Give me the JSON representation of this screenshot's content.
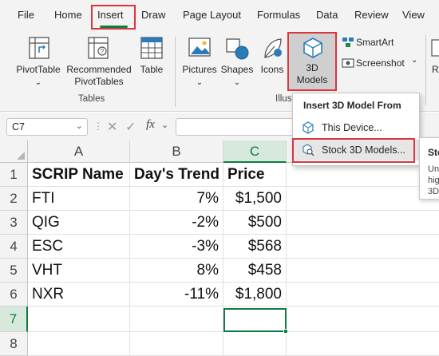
{
  "tabs": [
    "File",
    "Home",
    "Insert",
    "Draw",
    "Page Layout",
    "Formulas",
    "Data",
    "Review",
    "View"
  ],
  "ribbon": {
    "tables_group": {
      "label": "Tables",
      "pivottable": "PivotTable",
      "pivottable_arrow": "⌄",
      "recommended_line1": "Recommended",
      "recommended_line2": "PivotTables",
      "table": "Table"
    },
    "illustrations_group": {
      "label_partial": "Illus",
      "pictures": "Pictures",
      "shapes": "Shapes",
      "icons": "Icons",
      "models_line1": "3D",
      "models_line2": "Models",
      "smartart": "SmartArt",
      "screenshot": "Screenshot",
      "chevron": "⌄",
      "right_partial": "Re"
    }
  },
  "formula_bar": {
    "name_box": "C7",
    "fx": "fx"
  },
  "columns": [
    "A",
    "B",
    "C"
  ],
  "rows": [
    "1",
    "2",
    "3",
    "4",
    "5",
    "6",
    "7",
    "8"
  ],
  "table": {
    "headers": [
      "SCRIP Name",
      "Day's Trend",
      "Price"
    ],
    "data": [
      [
        "FTI",
        "7%",
        "$1,500"
      ],
      [
        "QIG",
        "-2%",
        "$500"
      ],
      [
        "ESC",
        "-3%",
        "$568"
      ],
      [
        "VHT",
        "8%",
        "$458"
      ],
      [
        "NXR",
        "-11%",
        "$1,800"
      ]
    ]
  },
  "dropdown": {
    "title": "Insert 3D Model From",
    "items": [
      "This Device...",
      "Stock 3D Models..."
    ]
  },
  "tooltip": {
    "title_partial": "Sto",
    "line1_partial": "Un",
    "line2_partial": "hig",
    "line3_partial": "3D"
  },
  "colors": {
    "excel_green": "#107c41",
    "highlight_red": "#d9363e",
    "ribbon_bg": "#f3f3f3"
  }
}
